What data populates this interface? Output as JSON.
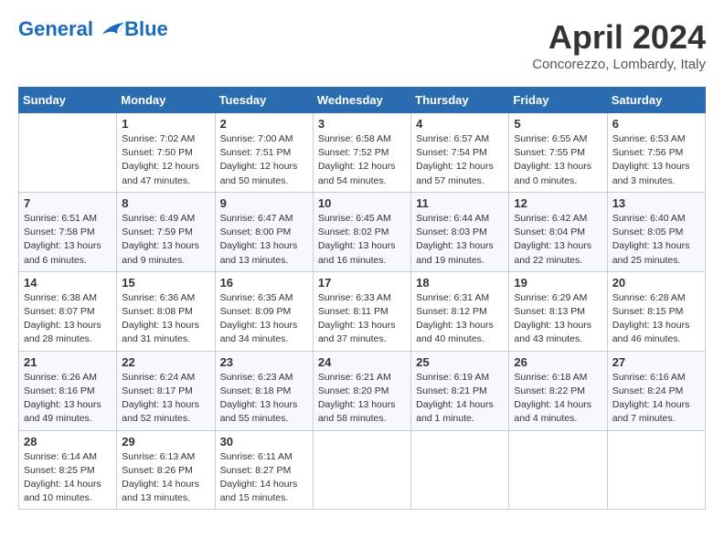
{
  "header": {
    "logo_line1": "General",
    "logo_line2": "Blue",
    "month_title": "April 2024",
    "location": "Concorezzo, Lombardy, Italy"
  },
  "weekdays": [
    "Sunday",
    "Monday",
    "Tuesday",
    "Wednesday",
    "Thursday",
    "Friday",
    "Saturday"
  ],
  "weeks": [
    [
      {
        "day": "",
        "info": ""
      },
      {
        "day": "1",
        "info": "Sunrise: 7:02 AM\nSunset: 7:50 PM\nDaylight: 12 hours\nand 47 minutes."
      },
      {
        "day": "2",
        "info": "Sunrise: 7:00 AM\nSunset: 7:51 PM\nDaylight: 12 hours\nand 50 minutes."
      },
      {
        "day": "3",
        "info": "Sunrise: 6:58 AM\nSunset: 7:52 PM\nDaylight: 12 hours\nand 54 minutes."
      },
      {
        "day": "4",
        "info": "Sunrise: 6:57 AM\nSunset: 7:54 PM\nDaylight: 12 hours\nand 57 minutes."
      },
      {
        "day": "5",
        "info": "Sunrise: 6:55 AM\nSunset: 7:55 PM\nDaylight: 13 hours\nand 0 minutes."
      },
      {
        "day": "6",
        "info": "Sunrise: 6:53 AM\nSunset: 7:56 PM\nDaylight: 13 hours\nand 3 minutes."
      }
    ],
    [
      {
        "day": "7",
        "info": "Sunrise: 6:51 AM\nSunset: 7:58 PM\nDaylight: 13 hours\nand 6 minutes."
      },
      {
        "day": "8",
        "info": "Sunrise: 6:49 AM\nSunset: 7:59 PM\nDaylight: 13 hours\nand 9 minutes."
      },
      {
        "day": "9",
        "info": "Sunrise: 6:47 AM\nSunset: 8:00 PM\nDaylight: 13 hours\nand 13 minutes."
      },
      {
        "day": "10",
        "info": "Sunrise: 6:45 AM\nSunset: 8:02 PM\nDaylight: 13 hours\nand 16 minutes."
      },
      {
        "day": "11",
        "info": "Sunrise: 6:44 AM\nSunset: 8:03 PM\nDaylight: 13 hours\nand 19 minutes."
      },
      {
        "day": "12",
        "info": "Sunrise: 6:42 AM\nSunset: 8:04 PM\nDaylight: 13 hours\nand 22 minutes."
      },
      {
        "day": "13",
        "info": "Sunrise: 6:40 AM\nSunset: 8:05 PM\nDaylight: 13 hours\nand 25 minutes."
      }
    ],
    [
      {
        "day": "14",
        "info": "Sunrise: 6:38 AM\nSunset: 8:07 PM\nDaylight: 13 hours\nand 28 minutes."
      },
      {
        "day": "15",
        "info": "Sunrise: 6:36 AM\nSunset: 8:08 PM\nDaylight: 13 hours\nand 31 minutes."
      },
      {
        "day": "16",
        "info": "Sunrise: 6:35 AM\nSunset: 8:09 PM\nDaylight: 13 hours\nand 34 minutes."
      },
      {
        "day": "17",
        "info": "Sunrise: 6:33 AM\nSunset: 8:11 PM\nDaylight: 13 hours\nand 37 minutes."
      },
      {
        "day": "18",
        "info": "Sunrise: 6:31 AM\nSunset: 8:12 PM\nDaylight: 13 hours\nand 40 minutes."
      },
      {
        "day": "19",
        "info": "Sunrise: 6:29 AM\nSunset: 8:13 PM\nDaylight: 13 hours\nand 43 minutes."
      },
      {
        "day": "20",
        "info": "Sunrise: 6:28 AM\nSunset: 8:15 PM\nDaylight: 13 hours\nand 46 minutes."
      }
    ],
    [
      {
        "day": "21",
        "info": "Sunrise: 6:26 AM\nSunset: 8:16 PM\nDaylight: 13 hours\nand 49 minutes."
      },
      {
        "day": "22",
        "info": "Sunrise: 6:24 AM\nSunset: 8:17 PM\nDaylight: 13 hours\nand 52 minutes."
      },
      {
        "day": "23",
        "info": "Sunrise: 6:23 AM\nSunset: 8:18 PM\nDaylight: 13 hours\nand 55 minutes."
      },
      {
        "day": "24",
        "info": "Sunrise: 6:21 AM\nSunset: 8:20 PM\nDaylight: 13 hours\nand 58 minutes."
      },
      {
        "day": "25",
        "info": "Sunrise: 6:19 AM\nSunset: 8:21 PM\nDaylight: 14 hours\nand 1 minute."
      },
      {
        "day": "26",
        "info": "Sunrise: 6:18 AM\nSunset: 8:22 PM\nDaylight: 14 hours\nand 4 minutes."
      },
      {
        "day": "27",
        "info": "Sunrise: 6:16 AM\nSunset: 8:24 PM\nDaylight: 14 hours\nand 7 minutes."
      }
    ],
    [
      {
        "day": "28",
        "info": "Sunrise: 6:14 AM\nSunset: 8:25 PM\nDaylight: 14 hours\nand 10 minutes."
      },
      {
        "day": "29",
        "info": "Sunrise: 6:13 AM\nSunset: 8:26 PM\nDaylight: 14 hours\nand 13 minutes."
      },
      {
        "day": "30",
        "info": "Sunrise: 6:11 AM\nSunset: 8:27 PM\nDaylight: 14 hours\nand 15 minutes."
      },
      {
        "day": "",
        "info": ""
      },
      {
        "day": "",
        "info": ""
      },
      {
        "day": "",
        "info": ""
      },
      {
        "day": "",
        "info": ""
      }
    ]
  ]
}
